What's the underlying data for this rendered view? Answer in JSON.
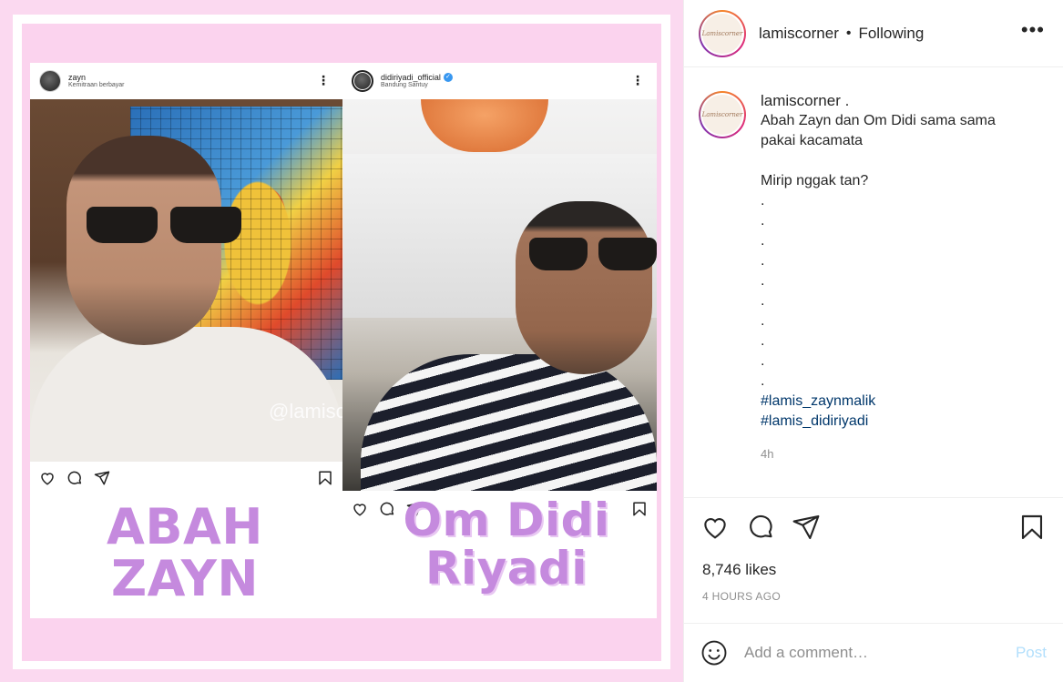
{
  "post_image": {
    "left_card": {
      "username": "zayn",
      "subtitle": "Kemitraan berbayar",
      "watermark": "@lamiscorner",
      "label": "ABAH ZAYN"
    },
    "right_card": {
      "username": "didiriyadi_official",
      "subtitle": "Bandung Santuy",
      "label": "Om Didi Riyadi"
    }
  },
  "header": {
    "username": "lamiscorner",
    "separator": "•",
    "follow_status": "Following",
    "avatar_text": "Lamiscorner"
  },
  "caption": {
    "username": "lamiscorner .",
    "line1": "Abah Zayn dan Om Didi sama sama",
    "line2": "pakai kacamata",
    "line3": "Mirip nggak tan?",
    "dots": [
      ".",
      ".",
      ".",
      ".",
      ".",
      ".",
      ".",
      ".",
      ".",
      "."
    ],
    "hashtag1": "#lamis_zaynmalik",
    "hashtag2": "#lamis_didiriyadi",
    "time": "4h"
  },
  "stats": {
    "likes": "8,746 likes",
    "posted": "4 HOURS AGO"
  },
  "comment_box": {
    "placeholder": "Add a comment…",
    "post_label": "Post"
  },
  "icons": [
    "heart-icon",
    "comment-icon",
    "share-icon",
    "bookmark-icon",
    "emoji-icon",
    "more-icon",
    "verified-icon"
  ],
  "colors": {
    "hashtag": "#00376b",
    "post_button": "#b2dffc",
    "label_purple": "#c58ade",
    "background_pink": "#fbd9f0"
  }
}
